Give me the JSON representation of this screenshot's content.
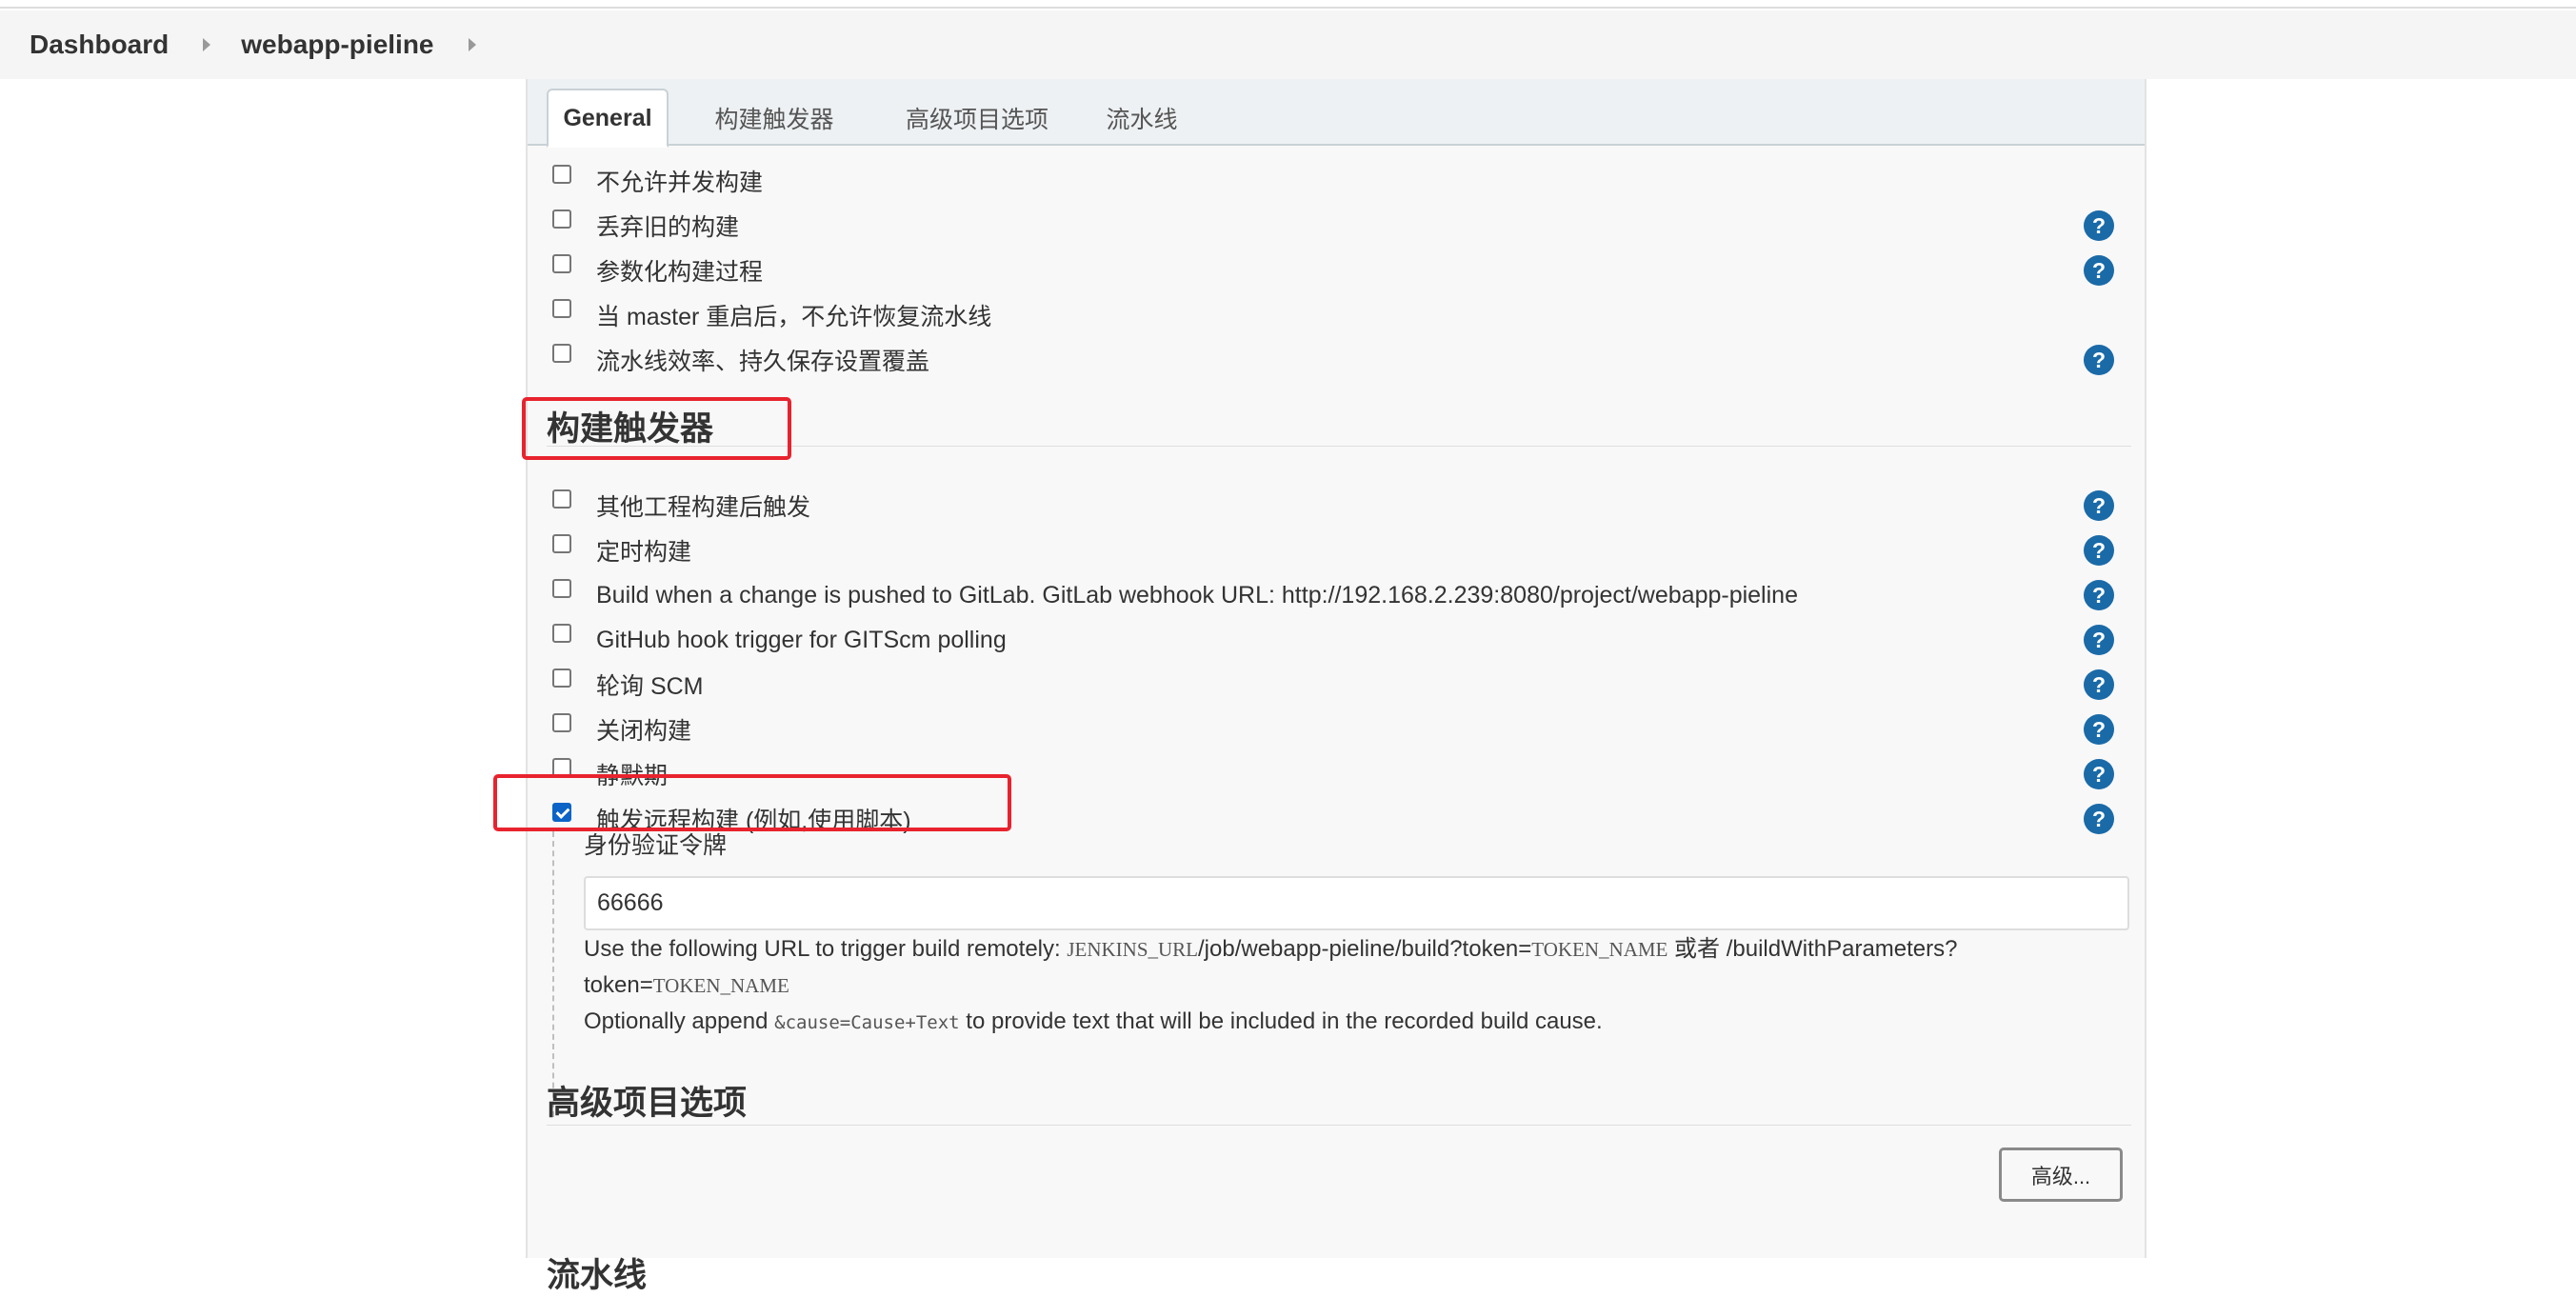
{
  "breadcrumb": {
    "items": [
      "Dashboard",
      "webapp-pieline"
    ]
  },
  "tabs": [
    {
      "label": "General",
      "active": true
    },
    {
      "label": "构建触发器",
      "active": false
    },
    {
      "label": "高级项目选项",
      "active": false
    },
    {
      "label": "流水线",
      "active": false
    }
  ],
  "general": {
    "options": [
      {
        "label": "不允许并发构建",
        "checked": false,
        "help": false
      },
      {
        "label": "丢弃旧的构建",
        "checked": false,
        "help": true
      },
      {
        "label": "参数化构建过程",
        "checked": false,
        "help": true
      },
      {
        "label": "当 master 重启后，不允许恢复流水线",
        "checked": false,
        "help": false
      },
      {
        "label": "流水线效率、持久保存设置覆盖",
        "checked": false,
        "help": true
      }
    ]
  },
  "triggers": {
    "title": "构建触发器",
    "options": [
      {
        "label": "其他工程构建后触发",
        "checked": false,
        "help": true
      },
      {
        "label": "定时构建",
        "checked": false,
        "help": true
      },
      {
        "label": "Build when a change is pushed to GitLab. GitLab webhook URL: http://192.168.2.239:8080/project/webapp-pieline",
        "checked": false,
        "help": true
      },
      {
        "label": "GitHub hook trigger for GITScm polling",
        "checked": false,
        "help": true
      },
      {
        "label": "轮询 SCM",
        "checked": false,
        "help": true
      },
      {
        "label": "关闭构建",
        "checked": false,
        "help": true
      },
      {
        "label": "静默期",
        "checked": false,
        "help": true
      },
      {
        "label": "触发远程构建 (例如,使用脚本)",
        "checked": true,
        "help": true
      }
    ],
    "remote": {
      "token_label": "身份验证令牌",
      "token_value": "66666",
      "help_line1_prefix": "Use the following URL to trigger build remotely: ",
      "help_jenkins_url": "JENKINS_URL",
      "help_path": "/job/webapp-pieline/build?token=",
      "help_token_name": "TOKEN_NAME",
      "help_or": " 或者 /buildWithParameters?",
      "help_line2_prefix": "token=",
      "help_line2_token": "TOKEN_NAME",
      "help_line3_prefix": "Optionally append ",
      "help_line3_code": "&cause=Cause+Text",
      "help_line3_suffix": " to provide text that will be included in the recorded build cause."
    }
  },
  "advanced": {
    "title": "高级项目选项",
    "button_label": "高级..."
  },
  "pipeline": {
    "title": "流水线"
  },
  "help_glyph": "?",
  "colors": {
    "help_icon": "#1a6aa8",
    "highlight_box": "#e8232e",
    "checkbox_checked": "#0b64c6"
  }
}
